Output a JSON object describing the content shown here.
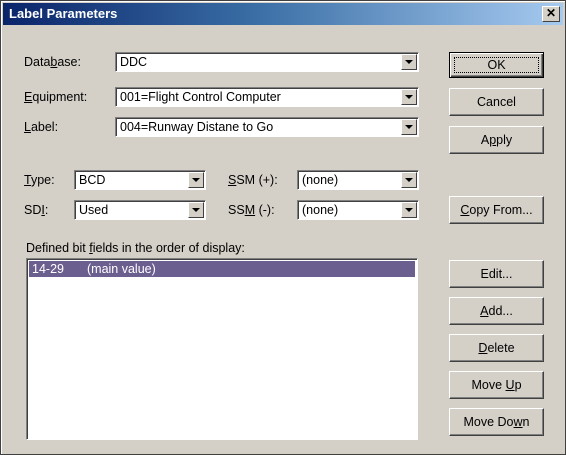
{
  "window": {
    "title": "Label Parameters",
    "close_label": "✕"
  },
  "fields": {
    "database": {
      "label_pre": "Data",
      "label_u": "b",
      "label_post": "ase:",
      "value": "DDC"
    },
    "equipment": {
      "label_pre": "",
      "label_u": "E",
      "label_post": "quipment:",
      "value": "001=Flight Control Computer"
    },
    "label": {
      "label_pre": "",
      "label_u": "L",
      "label_post": "abel:",
      "value": "004=Runway Distane to Go"
    },
    "type": {
      "label_pre": "",
      "label_u": "T",
      "label_post": "ype:",
      "value": "BCD"
    },
    "sdi": {
      "label_pre": "SD",
      "label_u": "I",
      "label_post": ":",
      "value": "Used"
    },
    "ssm_plus": {
      "label_pre": "",
      "label_u": "S",
      "label_post": "SM (+):",
      "value": "(none)"
    },
    "ssm_minus": {
      "label_pre": "SS",
      "label_u": "M",
      "label_post": " (-):",
      "value": "(none)"
    }
  },
  "bitfields": {
    "caption_pre": "Defined bit ",
    "caption_u": "f",
    "caption_post": "ields in the order of display:",
    "rows": [
      {
        "bits": "14-29",
        "name": "(main value)",
        "selected": true
      }
    ]
  },
  "buttons": {
    "ok": {
      "pre": "OK",
      "u": "",
      "post": ""
    },
    "cancel": {
      "pre": "Cancel",
      "u": "",
      "post": ""
    },
    "apply": {
      "pre": "A",
      "u": "p",
      "post": "ply"
    },
    "copy_from": {
      "pre": "",
      "u": "C",
      "post": "opy From..."
    },
    "edit": {
      "pre": "Edit...",
      "u": "",
      "post": ""
    },
    "add": {
      "pre": "",
      "u": "A",
      "post": "dd..."
    },
    "delete": {
      "pre": "",
      "u": "D",
      "post": "elete"
    },
    "move_up": {
      "pre": "Move ",
      "u": "U",
      "post": "p"
    },
    "move_down": {
      "pre": "Move Do",
      "u": "w",
      "post": "n"
    }
  }
}
